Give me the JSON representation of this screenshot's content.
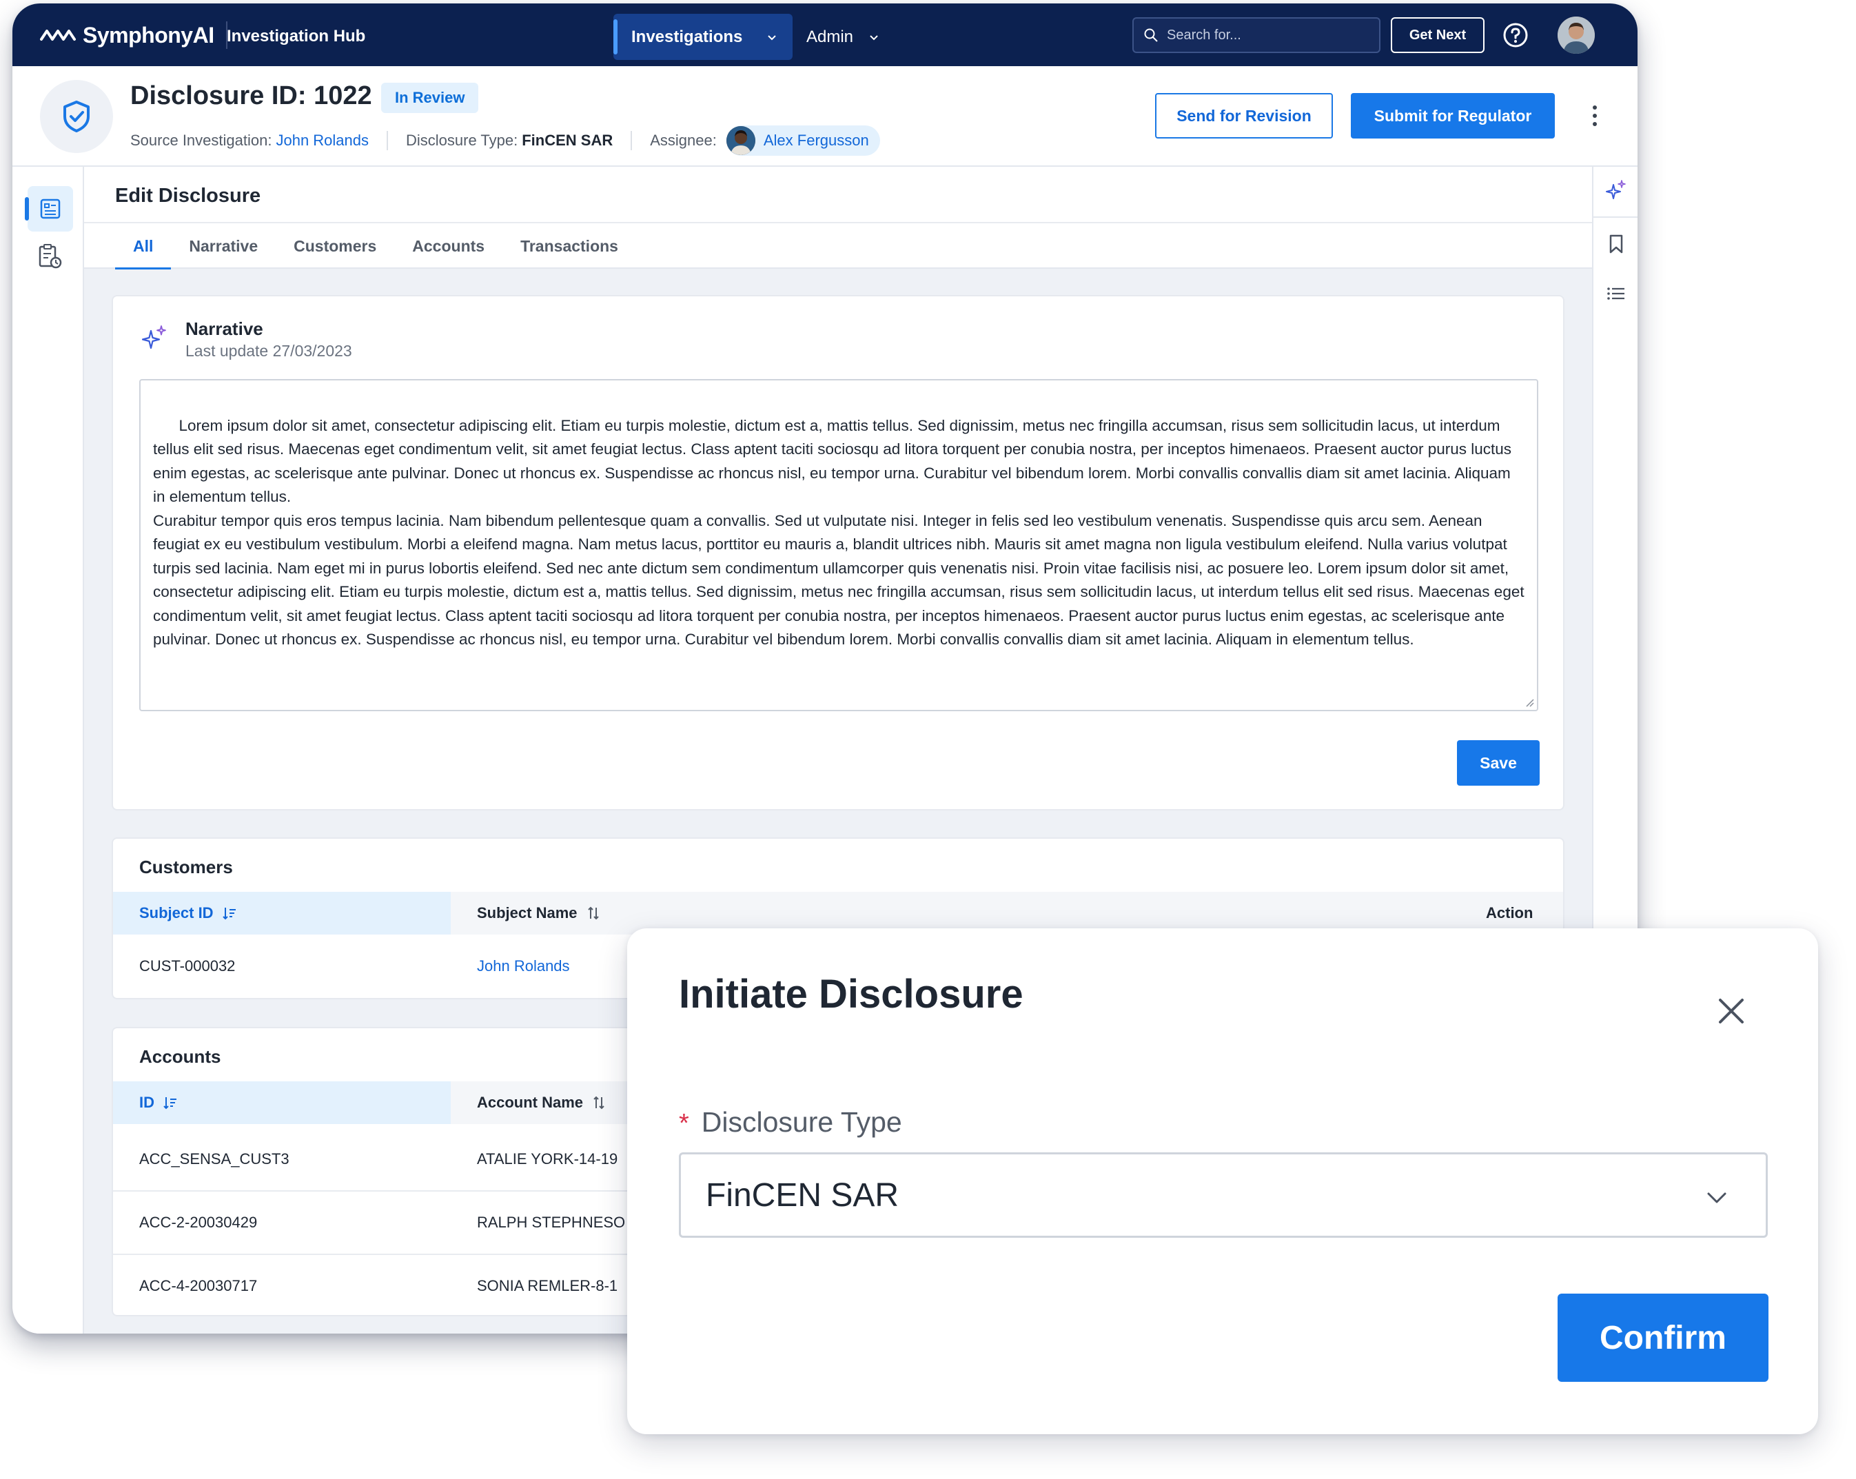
{
  "topbar": {
    "brand": "SymphonyAI",
    "app_name": "Investigation Hub",
    "nav": [
      {
        "label": "Investigations",
        "active": true
      },
      {
        "label": "Admin",
        "active": false
      }
    ],
    "search_placeholder": "Search for...",
    "get_next_label": "Get Next"
  },
  "header": {
    "title": "Disclosure ID: 1022",
    "status_badge": "In Review",
    "source_label": "Source Investigation:",
    "source_value": "John Rolands",
    "type_label": "Disclosure Type:",
    "type_value": "FinCEN SAR",
    "assignee_label": "Assignee:",
    "assignee_value": "Alex Fergusson",
    "send_revision_label": "Send for Revision",
    "submit_regulator_label": "Submit for Regulator"
  },
  "edit": {
    "title": "Edit Disclosure",
    "tabs": [
      "All",
      "Narrative",
      "Customers",
      "Accounts",
      "Transactions"
    ],
    "active_tab": "All"
  },
  "narrative": {
    "title": "Narrative",
    "last_update": "Last update 27/03/2023",
    "text": "Lorem ipsum dolor sit amet, consectetur adipiscing elit. Etiam eu turpis molestie, dictum est a, mattis tellus. Sed dignissim, metus nec fringilla accumsan, risus sem sollicitudin lacus, ut interdum tellus elit sed risus. Maecenas eget condimentum velit, sit amet feugiat lectus. Class aptent taciti sociosqu ad litora torquent per conubia nostra, per inceptos himenaeos. Praesent auctor purus luctus enim egestas, ac scelerisque ante pulvinar. Donec ut rhoncus ex. Suspendisse ac rhoncus nisl, eu tempor urna. Curabitur vel bibendum lorem. Morbi convallis convallis diam sit amet lacinia. Aliquam in elementum tellus.\nCurabitur tempor quis eros tempus lacinia. Nam bibendum pellentesque quam a convallis. Sed ut vulputate nisi. Integer in felis sed leo vestibulum venenatis. Suspendisse quis arcu sem. Aenean feugiat ex eu vestibulum vestibulum. Morbi a eleifend magna. Nam metus lacus, porttitor eu mauris a, blandit ultrices nibh. Mauris sit amet magna non ligula vestibulum eleifend. Nulla varius volutpat turpis sed lacinia. Nam eget mi in purus lobortis eleifend. Sed nec ante dictum sem condimentum ullamcorper quis venenatis nisi. Proin vitae facilisis nisi, ac posuere leo. Lorem ipsum dolor sit amet, consectetur adipiscing elit. Etiam eu turpis molestie, dictum est a, mattis tellus. Sed dignissim, metus nec fringilla accumsan, risus sem sollicitudin lacus, ut interdum tellus elit sed risus. Maecenas eget condimentum velit, sit amet feugiat lectus. Class aptent taciti sociosqu ad litora torquent per conubia nostra, per inceptos himenaeos. Praesent auctor purus luctus enim egestas, ac scelerisque ante pulvinar. Donec ut rhoncus ex. Suspendisse ac rhoncus nisl, eu tempor urna. Curabitur vel bibendum lorem. Morbi convallis convallis diam sit amet lacinia. Aliquam in elementum tellus.",
    "save_label": "Save"
  },
  "customers": {
    "title": "Customers",
    "columns": [
      "Subject ID",
      "Subject Name",
      "Action"
    ],
    "rows": [
      {
        "subject_id": "CUST-000032",
        "subject_name": "John Rolands"
      }
    ]
  },
  "accounts": {
    "title": "Accounts",
    "columns": [
      "ID",
      "Account Name"
    ],
    "rows": [
      {
        "id": "ACC_SENSA_CUST3",
        "name": "ATALIE YORK-14-19"
      },
      {
        "id": "ACC-2-20030429",
        "name": "RALPH STEPHNESO"
      },
      {
        "id": "ACC-4-20030717",
        "name": "SONIA REMLER-8-1"
      }
    ]
  },
  "modal": {
    "title": "Initiate Disclosure",
    "required_mark": "*",
    "field_label": "Disclosure Type",
    "field_value": "FinCEN SAR",
    "confirm_label": "Confirm"
  },
  "icons": {
    "brand": "symphony-wave-icon",
    "search": "search-icon",
    "help": "help-circle-icon",
    "shield": "shield-check-icon",
    "kebab": "more-vertical-icon",
    "sparkle": "ai-sparkle-icon",
    "bookmark": "bookmark-icon",
    "list": "list-icon",
    "close": "close-icon"
  },
  "colors": {
    "topbar": "#0c2150",
    "primary": "#1778e9",
    "link": "#1267d8",
    "badge_bg": "#e3f1fd",
    "required": "#d9304a"
  }
}
